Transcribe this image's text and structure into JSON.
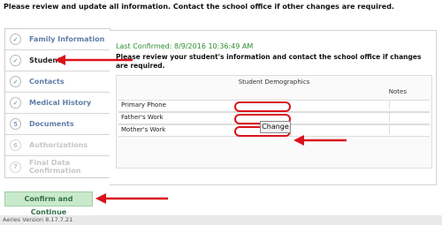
{
  "top_message": "Please review and update all information. Contact the school office if other changes are required.",
  "nav": {
    "items": [
      {
        "label": "Family Information",
        "marker": "✓",
        "state": "done"
      },
      {
        "label": "Student",
        "marker": "✓",
        "state": "active"
      },
      {
        "label": "Contacts",
        "marker": "✓",
        "state": "done"
      },
      {
        "label": "Medical History",
        "marker": "✓",
        "state": "done"
      },
      {
        "label": "Documents",
        "marker": "5",
        "state": "pending"
      },
      {
        "label": "Authorizations",
        "marker": "6",
        "state": "disabled"
      },
      {
        "label": "Final Data Confirmation",
        "marker": "7",
        "state": "disabled"
      }
    ]
  },
  "main": {
    "last_confirmed": "Last Confirmed: 8/9/2016 10:36:49 AM",
    "review_text": "Please review your student's information and contact the school office if changes are required.",
    "demographics": {
      "title": "Student Demographics",
      "notes_header": "Notes",
      "rows": [
        {
          "label": "Primary Phone",
          "value": ""
        },
        {
          "label": "Father's Work",
          "value": ""
        },
        {
          "label": "Mother's Work",
          "value": ""
        }
      ],
      "change_label": "Change"
    }
  },
  "confirm_button": "Confirm and Continue",
  "footer": "Aeries Version 8.17.7.21",
  "colors": {
    "arrow": "#d9131b",
    "nav_link": "#5f7da8",
    "confirmed_green": "#2f8f2f",
    "confirm_button_bg": "#c9e9cc"
  }
}
